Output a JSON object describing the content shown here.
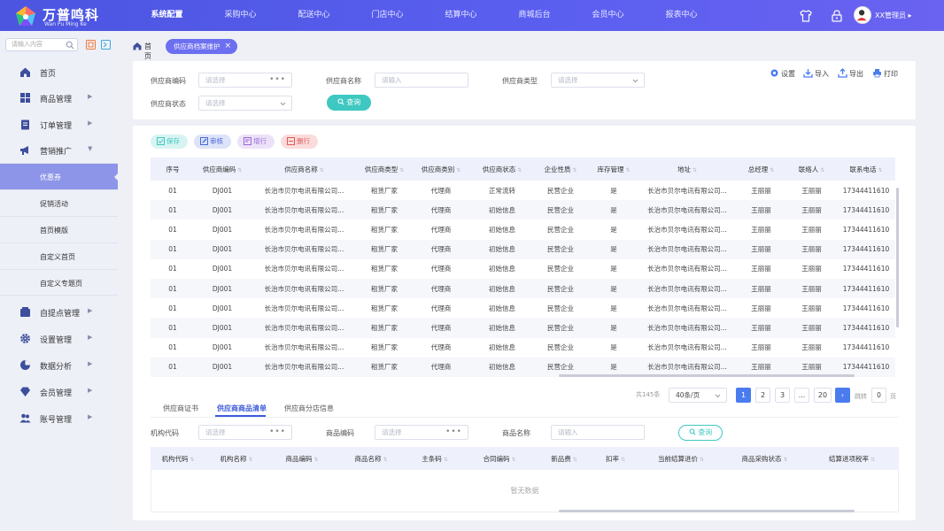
{
  "app": {
    "title": "万普鸣科",
    "subtitle": "Wan Pu Ming Ke"
  },
  "nav": {
    "items": [
      "系统配置",
      "采购中心",
      "配送中心",
      "门店中心",
      "结算中心",
      "商城后台",
      "会员中心",
      "报表中心"
    ],
    "active": "系统配置"
  },
  "user": {
    "name": "XX管理员"
  },
  "sidebar": {
    "search_placeholder": "请输入内容",
    "menu": [
      "首页",
      "商品管理",
      "订单管理",
      "营销推广"
    ],
    "submenu": [
      "优惠券",
      "促销活动",
      "首页模版",
      "自定义首页",
      "自定义专题页"
    ],
    "menu_after": [
      "自提点管理",
      "设置管理",
      "数据分析",
      "会员管理",
      "账号管理"
    ]
  },
  "breadcrumb": {
    "home": "首页",
    "current": "供应商档案维护",
    "close": "×"
  },
  "filters": {
    "code_label": "供应商编码",
    "code_placeholder": "请选择",
    "name_label": "供应商名称",
    "name_placeholder": "请输入",
    "type_label": "供应商类型",
    "type_placeholder": "请选择",
    "status_label": "供应商状态",
    "status_placeholder": "请选择",
    "query": "查询"
  },
  "toolbar": {
    "settings": "设置",
    "import": "导入",
    "export": "导出",
    "print": "打印"
  },
  "actions": {
    "save": "保存",
    "audit": "审核",
    "add_row": "增行",
    "delete_row": "删行"
  },
  "supplier_table": {
    "columns": [
      "序号",
      "供应商编码",
      "供应商名称",
      "供应商类型",
      "供应商类别",
      "供应商状态",
      "企业性质",
      "库存管理",
      "地址",
      "总经理",
      "联络人",
      "联系电话"
    ],
    "rows": [
      [
        "01",
        "DJ001",
        "长治市贝尔电讯有限公司...",
        "租赁厂家",
        "代理商",
        "正常流转",
        "民营企业",
        "是",
        "长治市贝尔电讯有限公司...",
        "王丽丽",
        "王丽丽",
        "17344411610"
      ],
      [
        "01",
        "DJ001",
        "长治市贝尔电讯有限公司...",
        "租赁厂家",
        "代理商",
        "初始信息",
        "民营企业",
        "是",
        "长治市贝尔电讯有限公司...",
        "王丽丽",
        "王丽丽",
        "17344411610"
      ],
      [
        "01",
        "DJ001",
        "长治市贝尔电讯有限公司...",
        "租赁厂家",
        "代理商",
        "初始信息",
        "民营企业",
        "是",
        "长治市贝尔电讯有限公司...",
        "王丽丽",
        "王丽丽",
        "17344411610"
      ],
      [
        "01",
        "DJ001",
        "长治市贝尔电讯有限公司...",
        "租赁厂家",
        "代理商",
        "初始信息",
        "民营企业",
        "是",
        "长治市贝尔电讯有限公司...",
        "王丽丽",
        "王丽丽",
        "17344411610"
      ],
      [
        "01",
        "DJ001",
        "长治市贝尔电讯有限公司...",
        "租赁厂家",
        "代理商",
        "初始信息",
        "民营企业",
        "是",
        "长治市贝尔电讯有限公司...",
        "王丽丽",
        "王丽丽",
        "17344411610"
      ],
      [
        "01",
        "DJ001",
        "长治市贝尔电讯有限公司...",
        "租赁厂家",
        "代理商",
        "初始信息",
        "民营企业",
        "是",
        "长治市贝尔电讯有限公司...",
        "王丽丽",
        "王丽丽",
        "17344411610"
      ],
      [
        "01",
        "DJ001",
        "长治市贝尔电讯有限公司...",
        "租赁厂家",
        "代理商",
        "初始信息",
        "民营企业",
        "是",
        "长治市贝尔电讯有限公司...",
        "王丽丽",
        "王丽丽",
        "17344411610"
      ],
      [
        "01",
        "DJ001",
        "长治市贝尔电讯有限公司...",
        "租赁厂家",
        "代理商",
        "初始信息",
        "民营企业",
        "是",
        "长治市贝尔电讯有限公司...",
        "王丽丽",
        "王丽丽",
        "17344411610"
      ],
      [
        "01",
        "DJ001",
        "长治市贝尔电讯有限公司...",
        "租赁厂家",
        "代理商",
        "初始信息",
        "民营企业",
        "是",
        "长治市贝尔电讯有限公司...",
        "王丽丽",
        "王丽丽",
        "17344411610"
      ],
      [
        "01",
        "DJ001",
        "长治市贝尔电讯有限公司...",
        "租赁厂家",
        "代理商",
        "初始信息",
        "民营企业",
        "是",
        "长治市贝尔电讯有限公司...",
        "王丽丽",
        "王丽丽",
        "17344411610"
      ]
    ],
    "status_ok": "正常流转"
  },
  "pagination": {
    "total": "共145条",
    "page_size": "40条/页",
    "pages": [
      "1",
      "2",
      "3",
      "...",
      "20"
    ],
    "current": "1",
    "jump_label": "跳转",
    "jump_value": "0",
    "page_suffix": "页",
    "next": "›"
  },
  "tabs": {
    "items": [
      "供应商证书",
      "供应商商品清单",
      "供应商分店信息"
    ],
    "active": "供应商商品清单"
  },
  "goods_filters": {
    "org_label": "机构代码",
    "org_placeholder": "请选择",
    "goods_code_label": "商品编码",
    "goods_code_placeholder": "请选择",
    "goods_name_label": "商品名称",
    "goods_name_placeholder": "请输入",
    "query": "查询"
  },
  "goods_table": {
    "columns": [
      "机构代码",
      "机构名称",
      "商品编码",
      "商品名称",
      "主条码",
      "合同编码",
      "新品费",
      "扣率",
      "当前结算进价",
      "商品采购状态",
      "结算进项税率"
    ],
    "empty": "暂无数据"
  },
  "colors": {
    "brand": "#5358e8",
    "teal": "#3ec8c1",
    "orange": "#f0a21b",
    "pager_active": "#4a7cf0"
  }
}
